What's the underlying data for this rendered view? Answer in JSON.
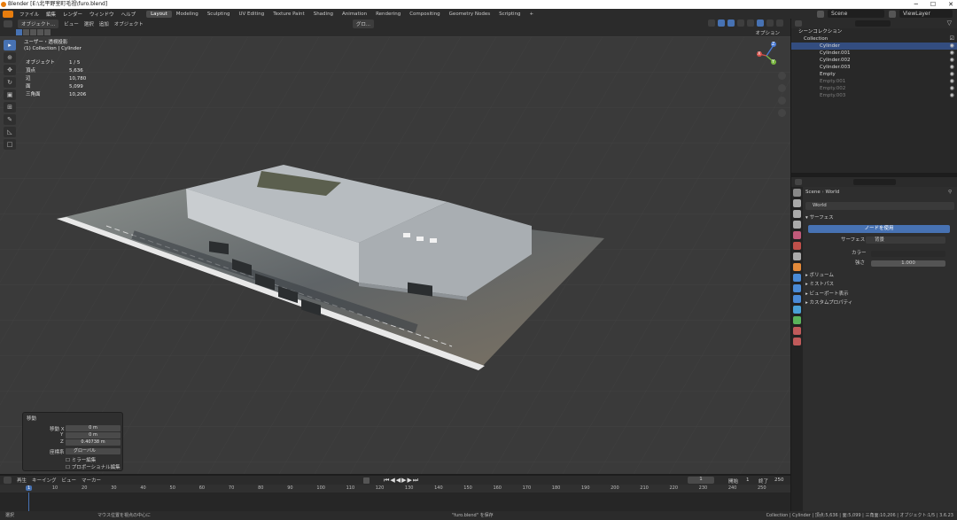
{
  "window": {
    "title": "Blender [E:\\北平野室町毛祖\\furo.blend]",
    "controls": [
      "─",
      "☐",
      "✕"
    ]
  },
  "menu": {
    "items": [
      "ファイル",
      "編集",
      "レンダー",
      "ウィンドウ",
      "ヘルプ"
    ],
    "workspaces": [
      "Layout",
      "Modeling",
      "Sculpting",
      "UV Editing",
      "Texture Paint",
      "Shading",
      "Animation",
      "Rendering",
      "Compositing",
      "Geometry Nodes",
      "Scripting"
    ],
    "active_workspace": "Layout",
    "add_tab": "+",
    "scene_label": "Scene",
    "viewlayer_label": "ViewLayer"
  },
  "viewport": {
    "mode": "オブジェクト...",
    "menus": [
      "ビュー",
      "選択",
      "追加",
      "オブジェクト"
    ],
    "transform": "グロ...",
    "options_label": "オプション",
    "view_name": "ユーザー・透視投影",
    "collection_path": "(1) Collection | Cylinder",
    "stats": [
      {
        "label": "オブジェクト",
        "value": "1 / 5"
      },
      {
        "label": "頂点",
        "value": "5,636"
      },
      {
        "label": "辺",
        "value": "10,780"
      },
      {
        "label": "面",
        "value": "5,099"
      },
      {
        "label": "三角面",
        "value": "10,206"
      }
    ],
    "gizmo_axes": {
      "x": "X",
      "y": "Y",
      "z": "Z"
    }
  },
  "last_operator": {
    "title": "移動",
    "rows": [
      {
        "label": "移動 X",
        "value": "0 m"
      },
      {
        "label": "Y",
        "value": "0 m"
      },
      {
        "label": "Z",
        "value": "0.40738 m"
      }
    ],
    "orientation_label": "座標系",
    "orientation_value": "グローバル",
    "checkboxes": [
      "ミラー編集",
      "プロポーショナル編集"
    ]
  },
  "timeline": {
    "menus": [
      "再生",
      "キーイング",
      "ビュー",
      "マーカー"
    ],
    "current_frame": "1",
    "start_label": "開始",
    "start_value": "1",
    "end_label": "終了",
    "end_value": "250",
    "ruler_ticks": [
      "1",
      "10",
      "20",
      "30",
      "40",
      "50",
      "60",
      "70",
      "80",
      "90",
      "100",
      "110",
      "120",
      "130",
      "140",
      "150",
      "160",
      "170",
      "180",
      "190",
      "200",
      "210",
      "220",
      "230",
      "240",
      "250"
    ]
  },
  "outliner": {
    "root": "シーンコレクション",
    "collection": "Collection",
    "items": [
      {
        "name": "Cylinder",
        "selected": true,
        "dim": false
      },
      {
        "name": "Cylinder.001",
        "selected": false,
        "dim": false
      },
      {
        "name": "Cylinder.002",
        "selected": false,
        "dim": false
      },
      {
        "name": "Cylinder.003",
        "selected": false,
        "dim": false
      },
      {
        "name": "Empty",
        "selected": false,
        "dim": false
      },
      {
        "name": "Empty.001",
        "selected": false,
        "dim": true
      },
      {
        "name": "Empty.002",
        "selected": false,
        "dim": true
      },
      {
        "name": "Empty.003",
        "selected": false,
        "dim": true
      }
    ]
  },
  "properties": {
    "breadcrumb_scene": "Scene",
    "breadcrumb_world": "World",
    "world_name": "World",
    "surface_section": "サーフェス",
    "use_nodes_button": "ノードを使用",
    "surface_label": "サーフェス",
    "surface_value": "背景",
    "color_label": "カラー",
    "strength_label": "強さ",
    "strength_value": "1.000",
    "collapsed_sections": [
      "ボリューム",
      "ミストパス",
      "ビューポート表示",
      "カスタムプロパティ"
    ]
  },
  "statusbar": {
    "left": "選択",
    "mid": "マウス位置を視点の中心に",
    "center": "\"furo.blend\" を保存",
    "right": "Collection | Cylinder | 頂点:5,636 | 面:5,099 | 三角面:10,206 | オブジェクト:1/5 | 3.6.23"
  }
}
